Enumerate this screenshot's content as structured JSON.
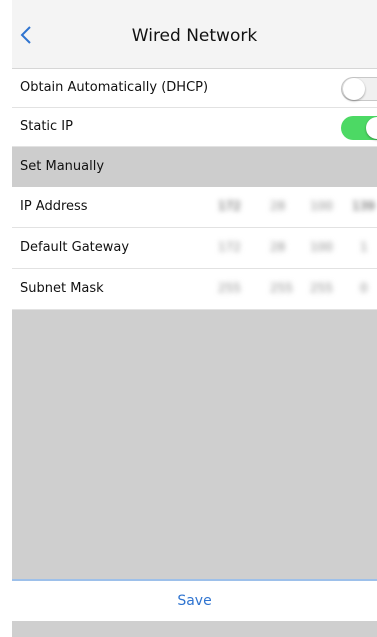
{
  "header": {
    "title": "Wired Network"
  },
  "toggles": [
    {
      "label": "Obtain Automatically (DHCP)",
      "state": "off"
    },
    {
      "label": "Static IP",
      "state": "on"
    }
  ],
  "section": {
    "label": "Set Manually"
  },
  "fields": [
    {
      "label": "IP Address",
      "octets": [
        "172",
        "28",
        "100",
        "139"
      ]
    },
    {
      "label": "Default Gateway",
      "octets": [
        "172",
        "28",
        "100",
        "1"
      ]
    },
    {
      "label": "Subnet Mask",
      "octets": [
        "255",
        "255",
        "255",
        "0"
      ]
    }
  ],
  "footer": {
    "save_label": "Save"
  },
  "colors": {
    "accent": "#2f74d0",
    "toggle_on": "#4cd964",
    "background": "#cfcfcf"
  }
}
